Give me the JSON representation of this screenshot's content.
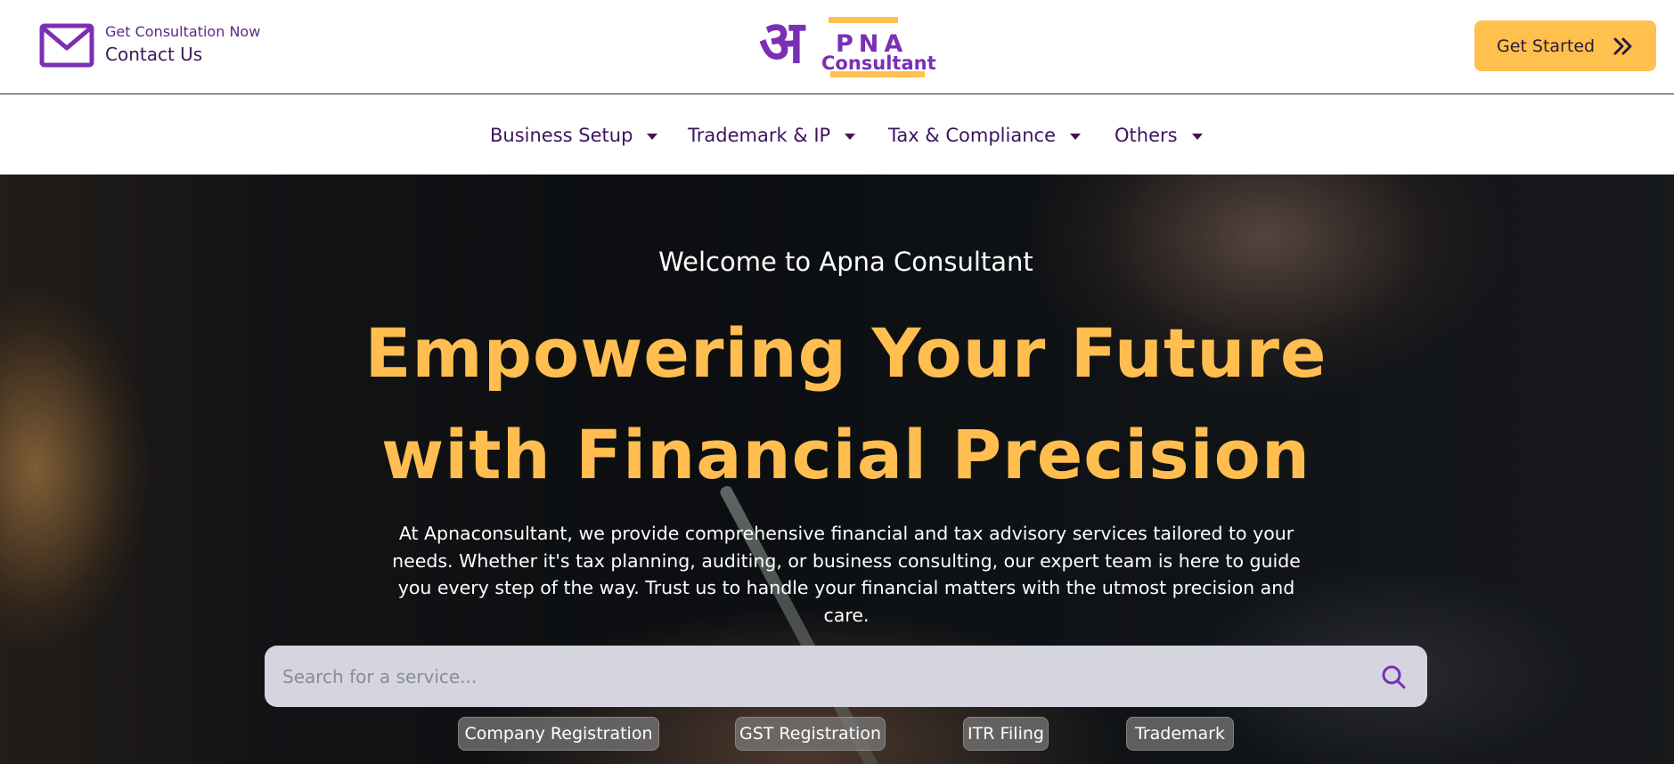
{
  "header": {
    "contact_sub": "Get Consultation Now",
    "contact_main": "Contact Us",
    "logo_devanagari": "अ",
    "logo_word_top": "PNA",
    "logo_word_bottom": "Consultant",
    "cta_label": "Get Started"
  },
  "nav": {
    "items": [
      {
        "label": "Business Setup"
      },
      {
        "label": "Trademark & IP"
      },
      {
        "label": "Tax & Compliance"
      },
      {
        "label": "Others"
      }
    ]
  },
  "hero": {
    "welcome": "Welcome to Apna Consultant",
    "headline_line1": "Empowering Your Future",
    "headline_line2": "with Financial Precision",
    "description": "At Apnaconsultant, we provide comprehensive financial and tax advisory services tailored to your needs. Whether it's tax planning, auditing, or business consulting, our expert team is here to guide you every step of the way. Trust us to handle your financial matters with the utmost precision and care.",
    "search_placeholder": "Search for a service...",
    "quick_links": [
      "Company Registration",
      "GST Registration",
      "ITR Filing",
      "Trademark"
    ]
  },
  "colors": {
    "brand_purple": "#7b2fb5",
    "accent_yellow": "#ffc04d",
    "headline_gold": "#ffbe4f"
  },
  "icons": {
    "contact": "mail-icon",
    "cta": "double-chevron-right-icon",
    "nav": "caret-down-icon",
    "search": "search-icon"
  }
}
